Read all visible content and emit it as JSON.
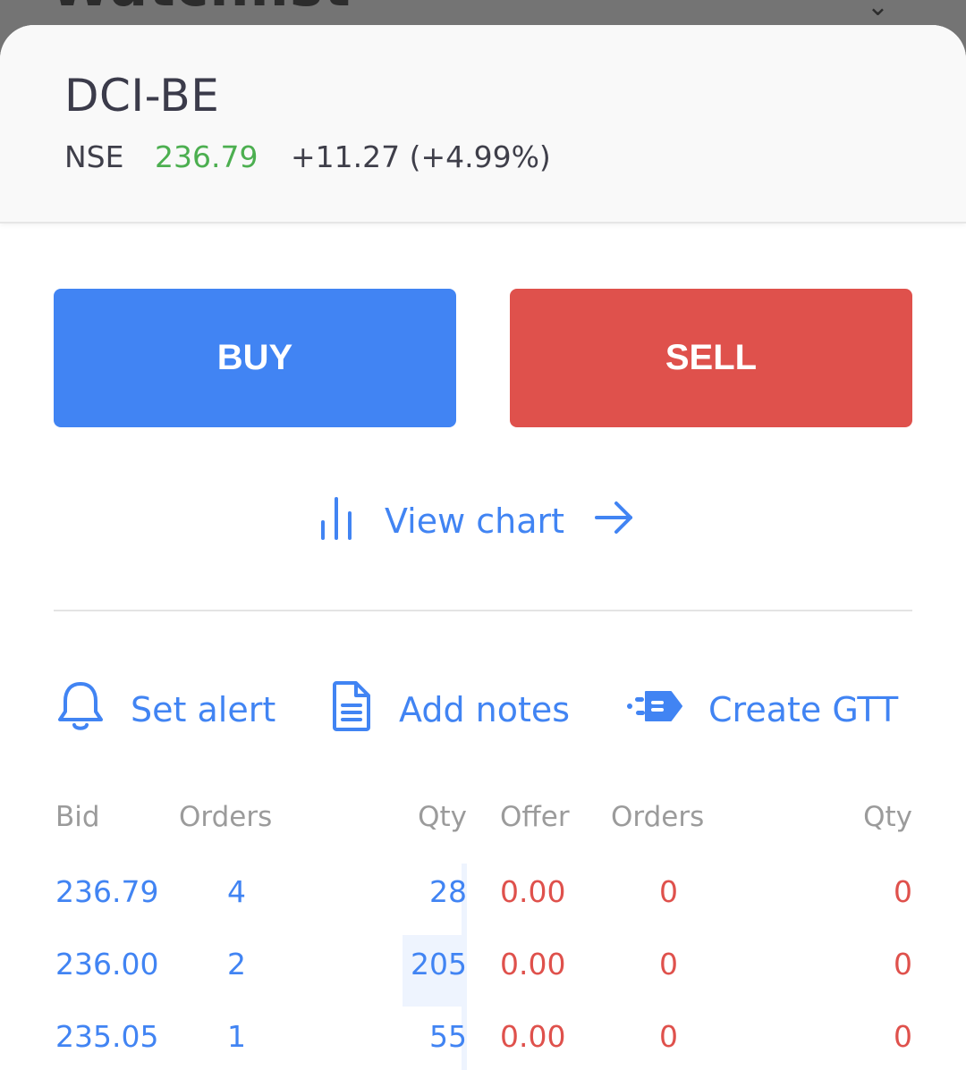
{
  "background": {
    "title": "Watchlist"
  },
  "instrument": {
    "symbol": "DCI-BE",
    "exchange": "NSE",
    "ltp": "236.79",
    "change": "+11.27 (+4.99%)"
  },
  "actions": {
    "buy_label": "BUY",
    "sell_label": "SELL",
    "view_chart_label": "View chart",
    "set_alert_label": "Set alert",
    "add_notes_label": "Add notes",
    "create_gtt_label": "Create GTT"
  },
  "depth": {
    "headers": [
      "Bid",
      "Orders",
      "Qty",
      "Offer",
      "Orders",
      "Qty"
    ],
    "rows": [
      {
        "bid": "236.79",
        "bid_orders": "4",
        "bid_qty": "28",
        "offer": "0.00",
        "offer_orders": "0",
        "offer_qty": "0"
      },
      {
        "bid": "236.00",
        "bid_orders": "2",
        "bid_qty": "205",
        "offer": "0.00",
        "offer_orders": "0",
        "offer_qty": "0"
      },
      {
        "bid": "235.05",
        "bid_orders": "1",
        "bid_qty": "55",
        "offer": "0.00",
        "offer_orders": "0",
        "offer_qty": "0"
      }
    ]
  },
  "colors": {
    "accent_blue": "#4184f3",
    "sell_red": "#df514c",
    "gain_green": "#4caf50"
  },
  "icons": [
    "bar-chart-icon",
    "arrow-right-icon",
    "bell-icon",
    "document-icon",
    "gtt-icon"
  ]
}
